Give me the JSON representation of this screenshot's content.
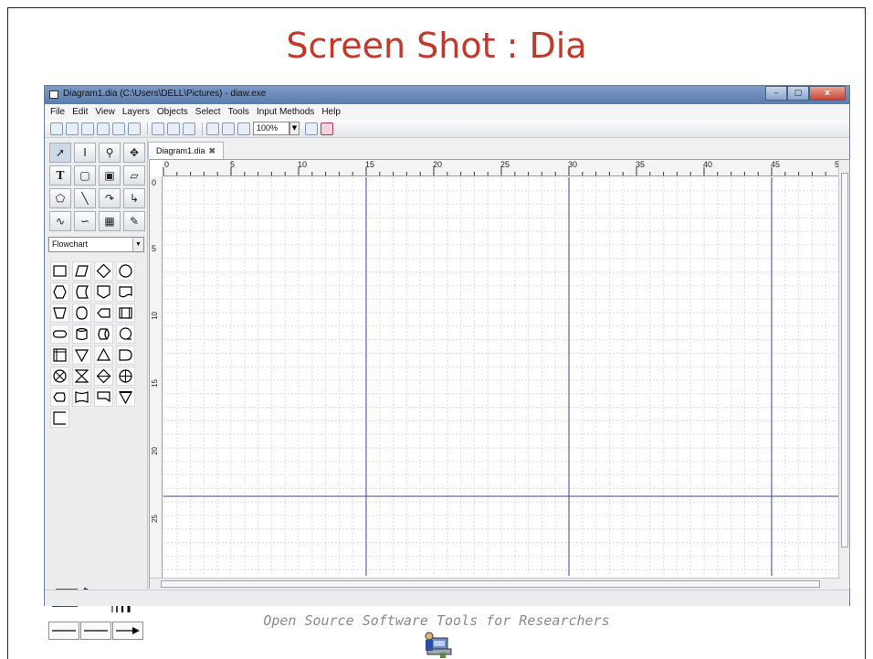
{
  "slide": {
    "title": "Screen Shot : Dia",
    "footer": "Open Source Software Tools for Researchers"
  },
  "window": {
    "title": "Diagram1.dia (C:\\Users\\DELL\\Pictures) - diaw.exe",
    "minimize": "–",
    "maximize": "▢",
    "close": "x"
  },
  "menu": [
    "File",
    "Edit",
    "View",
    "Layers",
    "Objects",
    "Select",
    "Tools",
    "Input Methods",
    "Help"
  ],
  "toolbar": {
    "zoom_value": "100%",
    "dropdown_arrow": "▼"
  },
  "toolbox": {
    "sheet": "Flowchart",
    "sheet_arrow": "▼"
  },
  "document": {
    "tab_label": "Diagram1.dia",
    "tab_close": "✖"
  },
  "ruler": {
    "horizontal": [
      "0",
      "5",
      "10",
      "15",
      "20",
      "25",
      "30",
      "35",
      "40",
      "45",
      "5"
    ],
    "vertical": [
      "0",
      "5",
      "10",
      "15",
      "20",
      "25"
    ]
  },
  "colors": {
    "title": "#c0392b",
    "grid_major": "#34449a",
    "grid_minor": "#d9dde6"
  }
}
